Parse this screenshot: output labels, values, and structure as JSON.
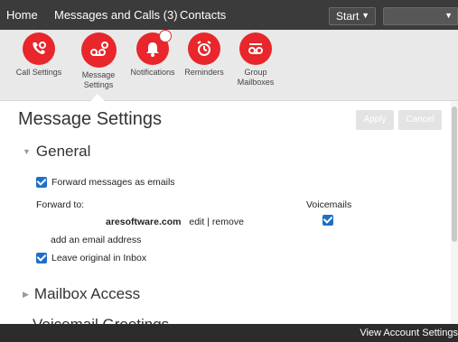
{
  "topnav": {
    "home": "Home",
    "messages": "Messages and Calls (3)",
    "contacts": "Contacts",
    "start": "Start",
    "user": ""
  },
  "toolbar": {
    "call_settings": "Call Settings",
    "message_settings": "Message Settings",
    "notifications": "Notifications",
    "reminders": "Reminders",
    "group_mailboxes": "Group Mailboxes"
  },
  "page": {
    "title": "Message Settings",
    "apply": "Apply",
    "cancel": "Cancel"
  },
  "general": {
    "heading": "General",
    "forward_label": "Forward messages as emails",
    "forward_to_label": "Forward to:",
    "voicemails_header": "Voicemails",
    "email": "aresoftware.com",
    "edit": "edit",
    "separator": "|",
    "remove": "remove",
    "add_email": "add an email address",
    "leave_original": "Leave original in Inbox"
  },
  "sections": {
    "mailbox_access": "Mailbox Access",
    "next_section_partial": "Voicemail Greetings"
  },
  "footer": {
    "view_account": "View Account Settings"
  },
  "colors": {
    "accent_red": "#e8262b",
    "checkbox_blue": "#1f6fc8",
    "topbar": "#3b3b3b"
  }
}
